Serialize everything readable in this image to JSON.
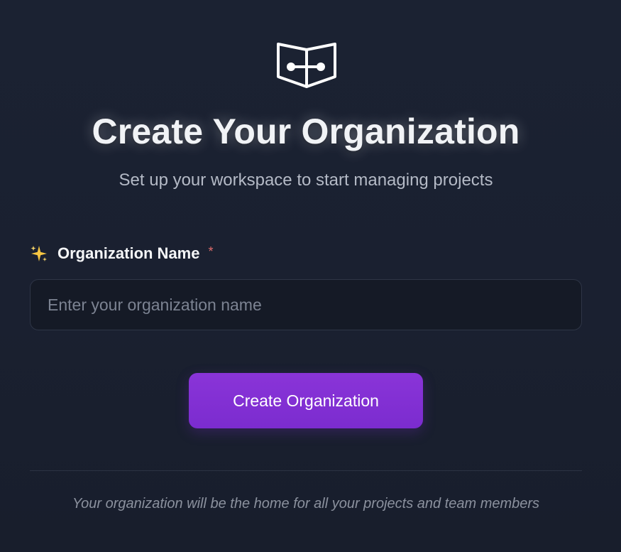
{
  "header": {
    "logo_icon": "book-connector-icon",
    "title": "Create Your Organization",
    "subtitle": "Set up your workspace to start managing projects"
  },
  "form": {
    "label_icon": "sparkles-icon",
    "org_name_label": "Organization Name",
    "required_marker": "*",
    "org_name_value": "",
    "org_name_placeholder": "Enter your organization name",
    "submit_label": "Create Organization"
  },
  "footer": {
    "note": "Your organization will be the home for all your projects and team members"
  },
  "colors": {
    "accent": "#8a34d8",
    "required": "#e06c6c",
    "background": "#1a2030"
  }
}
